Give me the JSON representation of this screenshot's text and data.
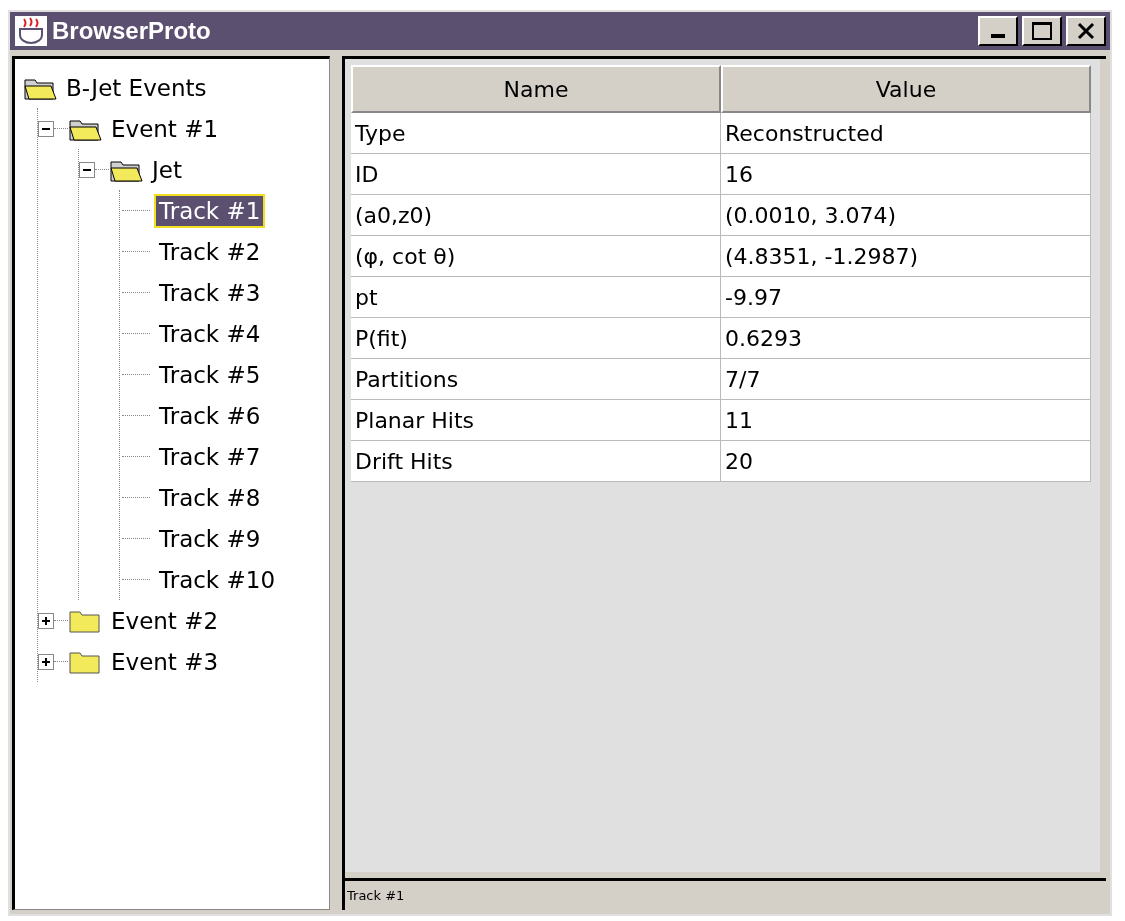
{
  "window": {
    "title": "BrowserProto"
  },
  "tree": [
    {
      "label": "B-Jet Events",
      "expanded": true,
      "selected": false,
      "children": [
        {
          "label": "Event #1",
          "expanded": true,
          "selected": false,
          "children": [
            {
              "label": "Jet",
              "expanded": true,
              "selected": false,
              "children": [
                {
                  "label": "Track #1",
                  "selected": true
                },
                {
                  "label": "Track #2",
                  "selected": false
                },
                {
                  "label": "Track #3",
                  "selected": false
                },
                {
                  "label": "Track #4",
                  "selected": false
                },
                {
                  "label": "Track #5",
                  "selected": false
                },
                {
                  "label": "Track #6",
                  "selected": false
                },
                {
                  "label": "Track #7",
                  "selected": false
                },
                {
                  "label": "Track #8",
                  "selected": false
                },
                {
                  "label": "Track #9",
                  "selected": false
                },
                {
                  "label": "Track #10",
                  "selected": false
                }
              ]
            }
          ]
        },
        {
          "label": "Event #2",
          "expanded": false,
          "selected": false
        },
        {
          "label": "Event #3",
          "expanded": false,
          "selected": false
        }
      ]
    }
  ],
  "table": {
    "columns": [
      "Name",
      "Value"
    ],
    "rows": [
      [
        "Type",
        "Reconstructed"
      ],
      [
        "ID",
        "16"
      ],
      [
        "(a0,z0)",
        "(0.0010, 3.074)"
      ],
      [
        "(φ, cot θ)",
        "(4.8351, -1.2987)"
      ],
      [
        "pt",
        "-9.97"
      ],
      [
        "P(fit)",
        "0.6293"
      ],
      [
        "Partitions",
        "7/7"
      ],
      [
        "Planar Hits",
        "11"
      ],
      [
        "Drift Hits",
        "20"
      ]
    ]
  },
  "status_bar": "Track #1"
}
